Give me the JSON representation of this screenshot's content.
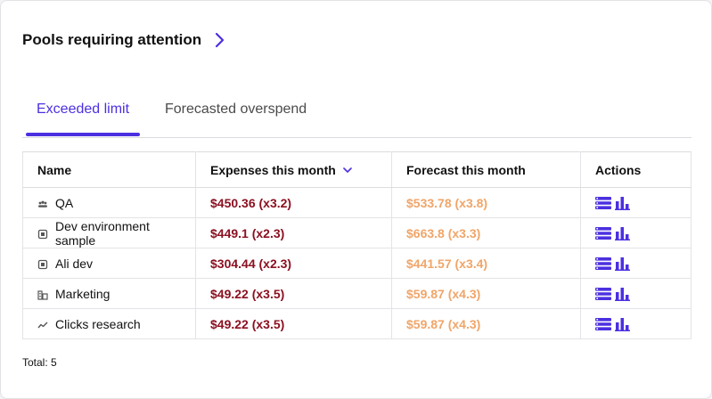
{
  "header": {
    "title": "Pools requiring attention"
  },
  "tabs": [
    {
      "label": "Exceeded limit",
      "active": true
    },
    {
      "label": "Forecasted overspend",
      "active": false
    }
  ],
  "table": {
    "columns": {
      "name": "Name",
      "expenses": "Expenses this month",
      "forecast": "Forecast this month",
      "actions": "Actions"
    },
    "rows": [
      {
        "icon": "team-icon",
        "name": "QA",
        "expenses": "$450.36 (x3.2)",
        "forecast": "$533.78 (x3.8)"
      },
      {
        "icon": "cpu-icon",
        "name": "Dev environment sample",
        "expenses": "$449.1 (x2.3)",
        "forecast": "$663.8 (x3.3)"
      },
      {
        "icon": "cpu-icon",
        "name": "Ali dev",
        "expenses": "$304.44 (x2.3)",
        "forecast": "$441.57 (x3.4)"
      },
      {
        "icon": "business-icon",
        "name": "Marketing",
        "expenses": "$49.22 (x3.5)",
        "forecast": "$59.87 (x4.3)"
      },
      {
        "icon": "trend-icon",
        "name": "Clicks research",
        "expenses": "$49.22 (x3.5)",
        "forecast": "$59.87 (x4.3)"
      }
    ]
  },
  "footer": {
    "total": "Total: 5"
  },
  "colors": {
    "accent": "#4b30e0",
    "expense": "#8b1020",
    "forecast": "#f0a569"
  }
}
